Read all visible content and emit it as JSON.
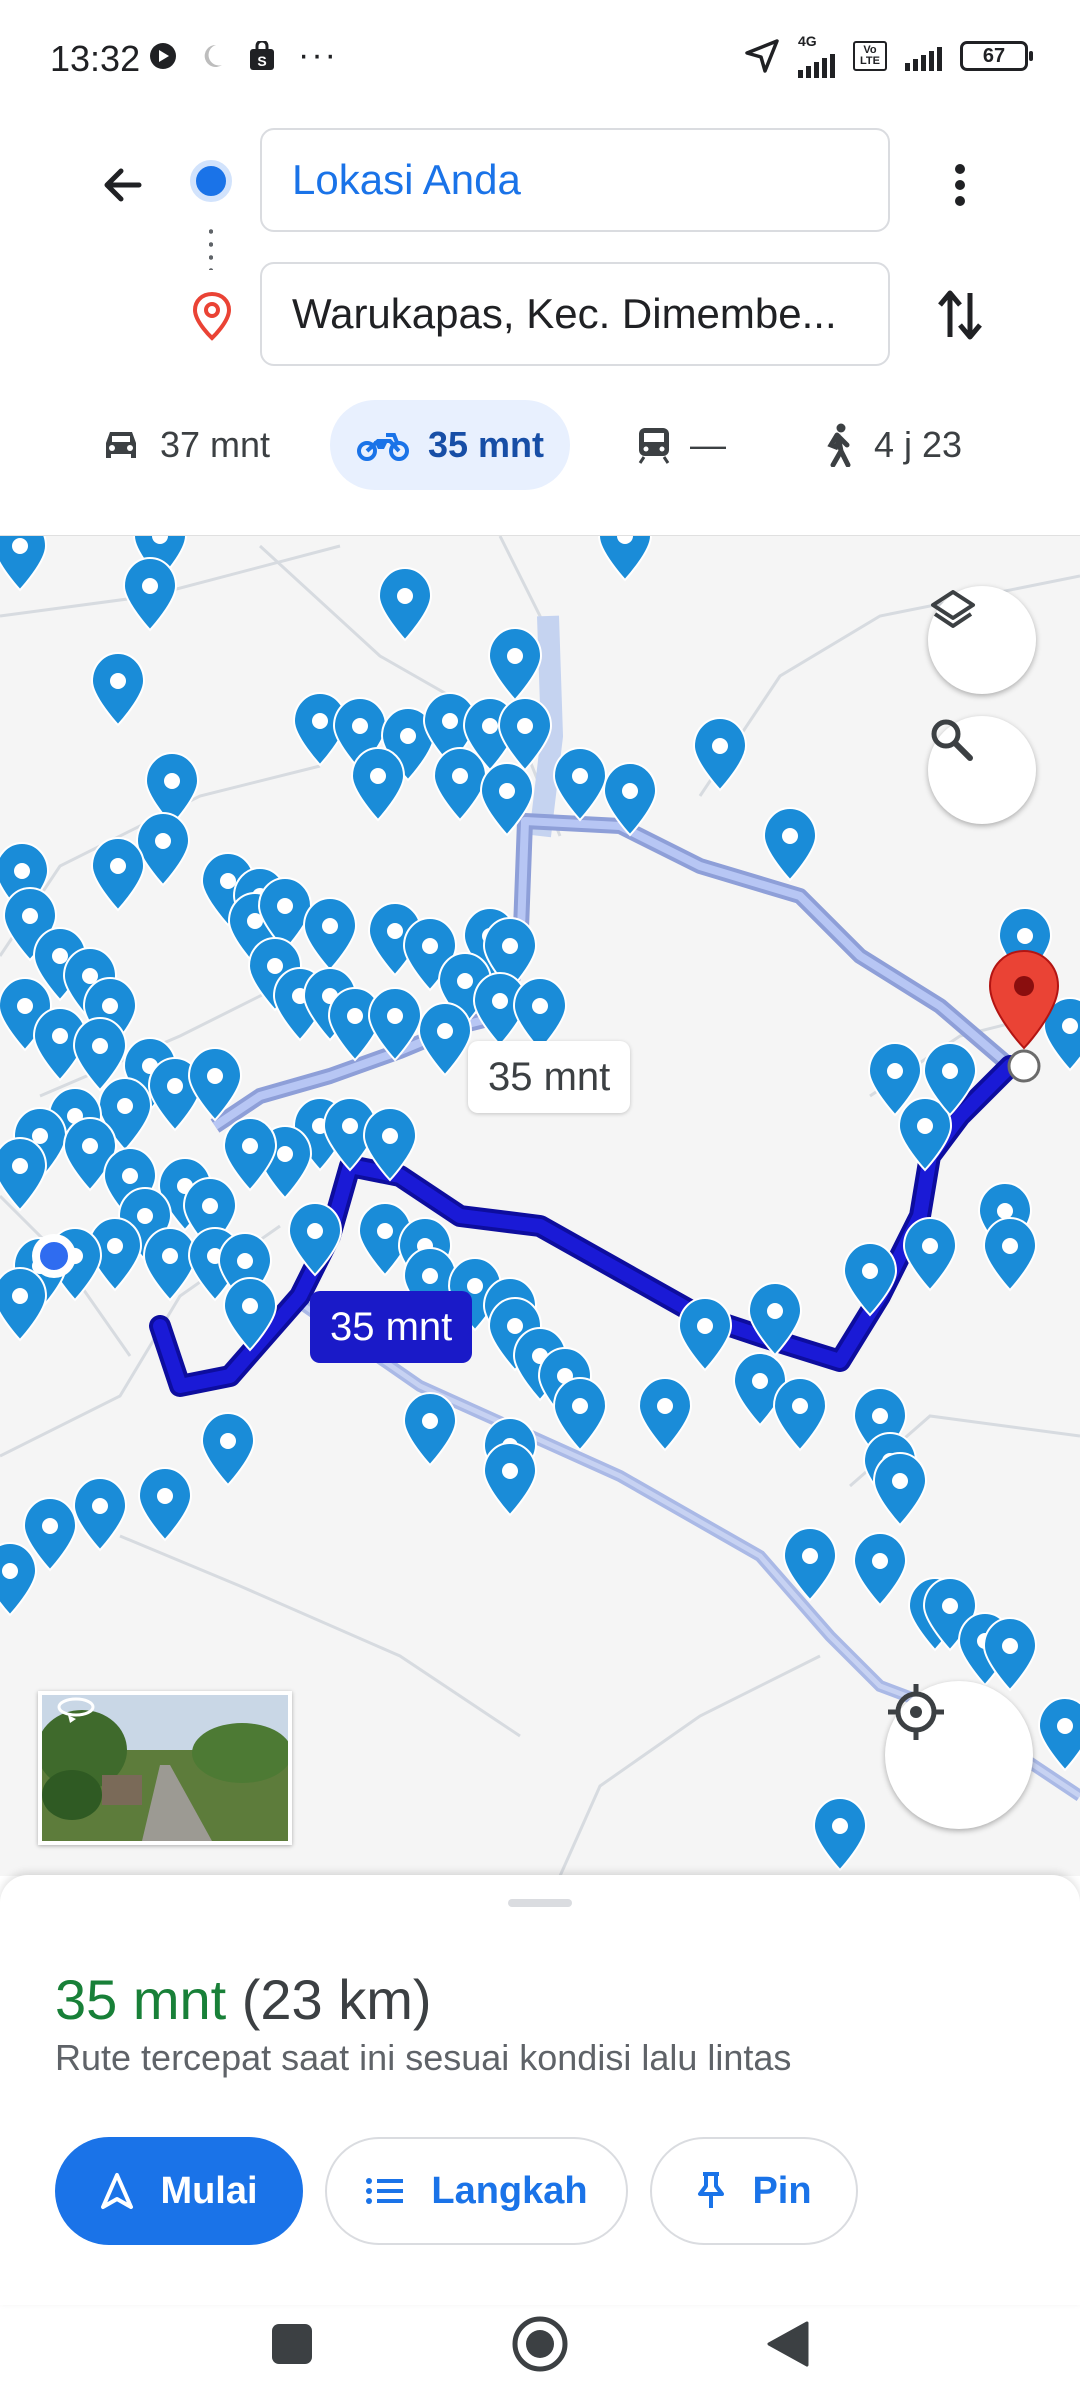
{
  "status_bar": {
    "time": "13:32",
    "more": "···",
    "network_tag": "4G",
    "volte_tag": "Vo LTE",
    "battery": "67"
  },
  "search": {
    "origin_value": "Lokasi Anda",
    "destination_value": "Warukapas, Kec. Dimembe..."
  },
  "modes": [
    {
      "icon": "car-icon",
      "label": "37 mnt"
    },
    {
      "icon": "motorcycle-icon",
      "label": "35 mnt",
      "active": true
    },
    {
      "icon": "transit-icon",
      "label": "—"
    },
    {
      "icon": "walk-icon",
      "label": "4 j 23"
    }
  ],
  "map": {
    "route_label_main": "35 mnt",
    "route_label_alt": "35 mnt",
    "route_color": "#1a1ad6",
    "alt_route_color": "#a8b8f0",
    "pin_color": "#1a8cd8",
    "destination_pin_color": "#ea4335"
  },
  "summary": {
    "duration": "35 mnt",
    "distance": "(23 km)",
    "description": "Rute tercepat saat ini sesuai kondisi lalu lintas"
  },
  "actions": {
    "start": "Mulai",
    "steps": "Langkah",
    "pin": "Pin"
  },
  "colors": {
    "accent": "#1a73e8",
    "duration_green": "#188038"
  }
}
